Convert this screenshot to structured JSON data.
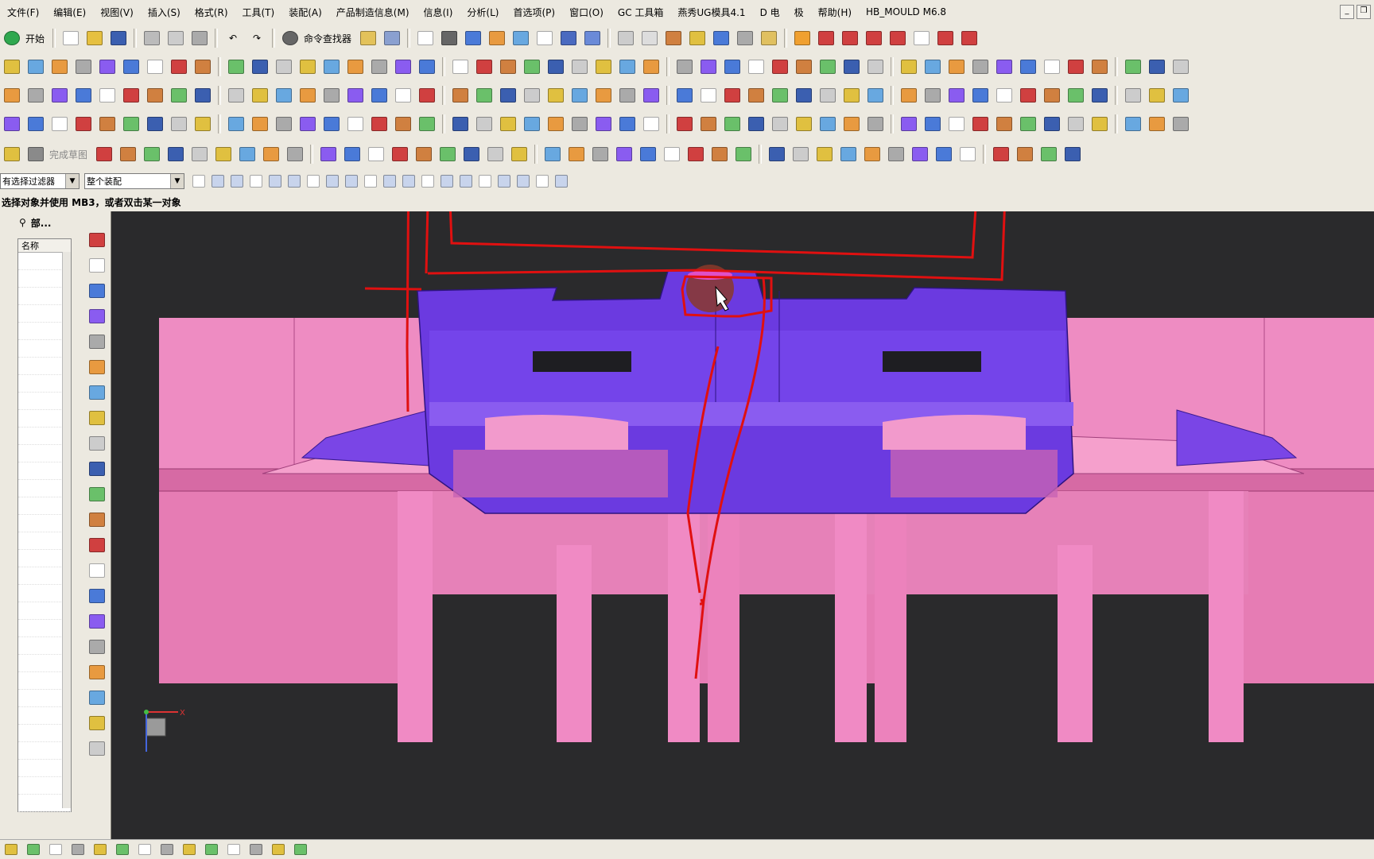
{
  "menu": [
    "文件(F)",
    "编辑(E)",
    "视图(V)",
    "插入(S)",
    "格式(R)",
    "工具(T)",
    "装配(A)",
    "产品制造信息(M)",
    "信息(I)",
    "分析(L)",
    "首选项(P)",
    "窗口(O)",
    "GC 工具箱",
    "燕秀UG模具4.1",
    "D 电",
    "极",
    "帮助(H)",
    "HB_MOULD M6.8"
  ],
  "toolbar1": {
    "start_label": "开始",
    "command_finder_label": "命令查找器"
  },
  "toolbar5": {
    "finish_sketch_label": "完成草图"
  },
  "selection_bar": {
    "filter_label": "有选择过滤器",
    "scope_label": "整个装配"
  },
  "cue_line": "选择对象并使用 MB3，或者双击某一对象",
  "nav_panel": {
    "title": "部...",
    "column_header": "名称"
  },
  "viewport": {
    "triad_x_label": "X"
  },
  "colors": {
    "pink_part": "#ea7fb8",
    "purple_part": "#7a3fe8",
    "annotation_red": "#e01010",
    "background": "#2a2a2c"
  }
}
